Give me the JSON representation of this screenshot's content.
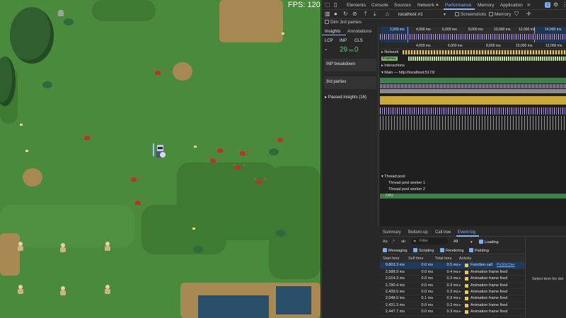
{
  "game": {
    "fps_label": "FPS: 120.1"
  },
  "devtools": {
    "tabs": [
      "Elements",
      "Console",
      "Sources",
      "Network",
      "Performance",
      "Memory",
      "Application"
    ],
    "active_tab": "Performance",
    "more_label": "»",
    "badge_count": "1",
    "toolbar": {
      "target": "localhost #1",
      "screenshots_label": "Screenshots",
      "memory_label": "Memory"
    },
    "dim_3rd_parties": "Dim 3rd parties",
    "sidebar": {
      "tabs": [
        "Insights",
        "Annotations"
      ],
      "metrics": [
        {
          "name": "LCP",
          "value": "-"
        },
        {
          "name": "INP",
          "value": "29",
          "unit": "ms"
        },
        {
          "name": "CLS",
          "value": "0"
        }
      ],
      "inp_breakdown": "INP breakdown",
      "third_parties": "3rd parties",
      "passed_insights": "Passed insights (16)"
    },
    "ruler_top": [
      "2,000 ms",
      "4,000 ms",
      "6,000 ms",
      "8,000 ms",
      "10,000 ms",
      "12,000 ms",
      "14,000 ms"
    ],
    "ruler_main": [
      "4,000 ms",
      "6,000 ms",
      "8,000 ms",
      "10,000 ms",
      "12,000 ms"
    ],
    "tracks": {
      "network": "Network",
      "frames": "Frames",
      "interactions": "Interactions",
      "main": "Main — http://localhost:5173/",
      "thread_pool": "Thread pool",
      "worker1": "Thread pool worker 1",
      "worker2": "Thread pool worker 2",
      "cpu": "CPU"
    },
    "bottom_tabs": [
      "Summary",
      "Bottom-up",
      "Call tree",
      "Event log"
    ],
    "active_bottom_tab": "Event log",
    "filter": {
      "placeholder": "Filter",
      "select": "All",
      "loading": "Loading"
    },
    "checkboxes": [
      "Messaging",
      "Scripting",
      "Rendering",
      "Painting"
    ],
    "columns": {
      "start": "Start time",
      "self": "Self time",
      "total": "Total time",
      "activity": "Activity"
    },
    "rows": [
      {
        "start": "9,803.3 ms",
        "self": "0.0 ms",
        "total": "0.5 ms",
        "activity": "Function call",
        "link": "PxSfsClier",
        "selected": true
      },
      {
        "start": "2,588.9 ms",
        "self": "0.0 ms",
        "total": "0.4 ms",
        "activity": "Animation frame fired"
      },
      {
        "start": "2,014.3 ms",
        "self": "0.0 ms",
        "total": "0.3 ms",
        "activity": "Animation frame fired"
      },
      {
        "start": "2,780.4 ms",
        "self": "0.0 ms",
        "total": "0.3 ms",
        "activity": "Animation frame fired"
      },
      {
        "start": "2,439.5 ms",
        "self": "0.0 ms",
        "total": "0.3 ms",
        "activity": "Animation frame fired"
      },
      {
        "start": "2,048.0 ms",
        "self": "0.1 ms",
        "total": "0.3 ms",
        "activity": "Animation frame fired"
      },
      {
        "start": "2,431.3 ms",
        "self": "0.0 ms",
        "total": "0.3 ms",
        "activity": "Animation frame fired"
      },
      {
        "start": "2,447.7 ms",
        "self": "0.0 ms",
        "total": "0.3 ms",
        "activity": "Animation frame fired"
      }
    ],
    "detail_hint": "Select item for det"
  },
  "colors": {
    "accent": "#8ab4f8",
    "main_track": "#3e7f4a",
    "scripting": "#f2c744",
    "rendering": "#9b7fe6"
  }
}
